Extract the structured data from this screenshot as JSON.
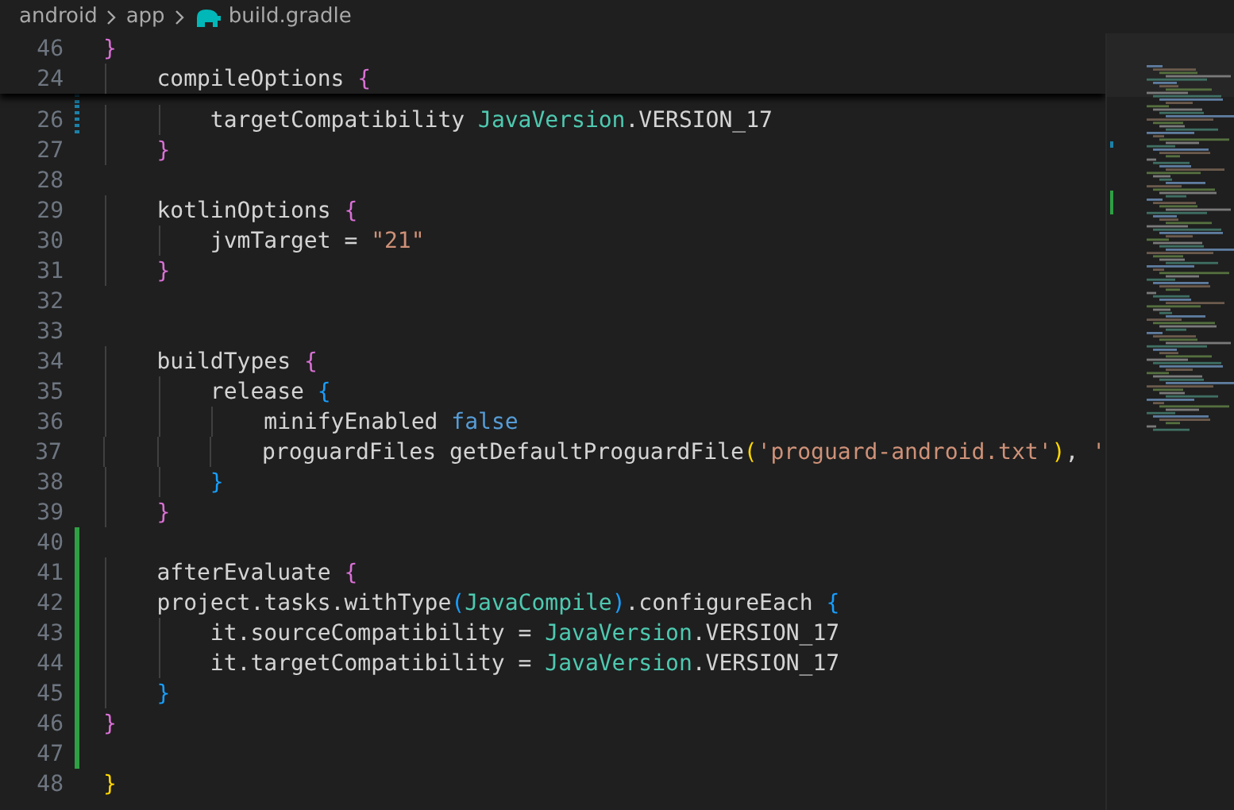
{
  "breadcrumb": [
    {
      "kind": "folder",
      "label": "android"
    },
    {
      "kind": "folder",
      "label": "app"
    },
    {
      "kind": "gradle",
      "label": "build.gradle"
    }
  ],
  "sticky_lines": [
    {
      "number": "46",
      "tokens": [
        {
          "kind": "brace",
          "text": "}",
          "color": "#da70d6"
        }
      ]
    },
    {
      "number": "24",
      "tokens": [
        {
          "kind": "plain",
          "text": "    compileOptions "
        },
        {
          "kind": "brace",
          "text": "{",
          "color": "#da70d6"
        }
      ]
    }
  ],
  "lines": [
    {
      "number": "26",
      "kind": "modified",
      "tokens": [
        {
          "kind": "plain",
          "text": "        targetCompatibility "
        },
        {
          "kind": "type",
          "text": "JavaVersion"
        },
        {
          "kind": "plain",
          "text": ".VERSION_17"
        }
      ]
    },
    {
      "number": "27",
      "kind": "plain",
      "tokens": [
        {
          "kind": "brace",
          "text": "    }",
          "color": "#da70d6"
        }
      ]
    },
    {
      "number": "28",
      "kind": "plain"
    },
    {
      "number": "29",
      "kind": "plain",
      "tokens": [
        {
          "kind": "plain",
          "text": "    kotlinOptions "
        },
        {
          "kind": "brace",
          "text": "{",
          "color": "#da70d6"
        }
      ]
    },
    {
      "number": "30",
      "kind": "plain",
      "tokens": [
        {
          "kind": "plain",
          "text": "        jvmTarget = "
        },
        {
          "kind": "string",
          "text": "\"21\""
        }
      ]
    },
    {
      "number": "31",
      "kind": "plain",
      "tokens": [
        {
          "kind": "brace",
          "text": "    }",
          "color": "#da70d6"
        }
      ]
    },
    {
      "number": "32",
      "kind": "plain"
    },
    {
      "number": "33",
      "kind": "plain"
    },
    {
      "number": "34",
      "kind": "plain",
      "tokens": [
        {
          "kind": "plain",
          "text": "    buildTypes "
        },
        {
          "kind": "brace",
          "text": "{",
          "color": "#da70d6"
        }
      ]
    },
    {
      "number": "35",
      "kind": "plain",
      "tokens": [
        {
          "kind": "plain",
          "text": "        release "
        },
        {
          "kind": "brace",
          "text": "{",
          "color": "#179fff"
        }
      ]
    },
    {
      "number": "36",
      "kind": "plain",
      "tokens": [
        {
          "kind": "plain",
          "text": "            minifyEnabled "
        },
        {
          "kind": "keyword",
          "text": "false"
        }
      ]
    },
    {
      "number": "37",
      "kind": "plain",
      "tokens": [
        {
          "kind": "plain",
          "text": "            proguardFiles getDefaultProguardFile"
        },
        {
          "kind": "brace",
          "text": "(",
          "color": "#ffd700"
        },
        {
          "kind": "string",
          "text": "'proguard-android.txt'"
        },
        {
          "kind": "brace",
          "text": ")",
          "color": "#ffd700"
        },
        {
          "kind": "plain",
          "text": ", "
        },
        {
          "kind": "string",
          "text": "'"
        }
      ]
    },
    {
      "number": "38",
      "kind": "plain",
      "tokens": [
        {
          "kind": "brace",
          "text": "        }",
          "color": "#179fff"
        }
      ]
    },
    {
      "number": "39",
      "kind": "plain",
      "tokens": [
        {
          "kind": "brace",
          "text": "    }",
          "color": "#da70d6"
        }
      ]
    },
    {
      "number": "40",
      "kind": "added"
    },
    {
      "number": "41",
      "kind": "added",
      "tokens": [
        {
          "kind": "plain",
          "text": "    afterEvaluate "
        },
        {
          "kind": "brace",
          "text": "{",
          "color": "#da70d6"
        }
      ]
    },
    {
      "number": "42",
      "kind": "added",
      "tokens": [
        {
          "kind": "plain",
          "text": "    project.tasks.withType"
        },
        {
          "kind": "brace",
          "text": "(",
          "color": "#179fff"
        },
        {
          "kind": "type",
          "text": "JavaCompile"
        },
        {
          "kind": "brace",
          "text": ")",
          "color": "#179fff"
        },
        {
          "kind": "plain",
          "text": ".configureEach "
        },
        {
          "kind": "brace",
          "text": "{",
          "color": "#179fff"
        }
      ]
    },
    {
      "number": "43",
      "kind": "added",
      "tokens": [
        {
          "kind": "plain",
          "text": "        it.sourceCompatibility = "
        },
        {
          "kind": "type",
          "text": "JavaVersion"
        },
        {
          "kind": "plain",
          "text": ".VERSION_17"
        }
      ]
    },
    {
      "number": "44",
      "kind": "added",
      "tokens": [
        {
          "kind": "plain",
          "text": "        it.targetCompatibility = "
        },
        {
          "kind": "type",
          "text": "JavaVersion"
        },
        {
          "kind": "plain",
          "text": ".VERSION_17"
        }
      ]
    },
    {
      "number": "45",
      "kind": "added",
      "tokens": [
        {
          "kind": "brace",
          "text": "    }",
          "color": "#179fff"
        }
      ]
    },
    {
      "number": "46",
      "kind": "added",
      "tokens": [
        {
          "kind": "brace",
          "text": "}",
          "color": "#da70d6"
        }
      ]
    },
    {
      "number": "47",
      "kind": "added"
    },
    {
      "number": "48",
      "kind": "plain",
      "tokens": [
        {
          "kind": "brace",
          "text": "}",
          "color": "#ffd700"
        }
      ]
    }
  ]
}
